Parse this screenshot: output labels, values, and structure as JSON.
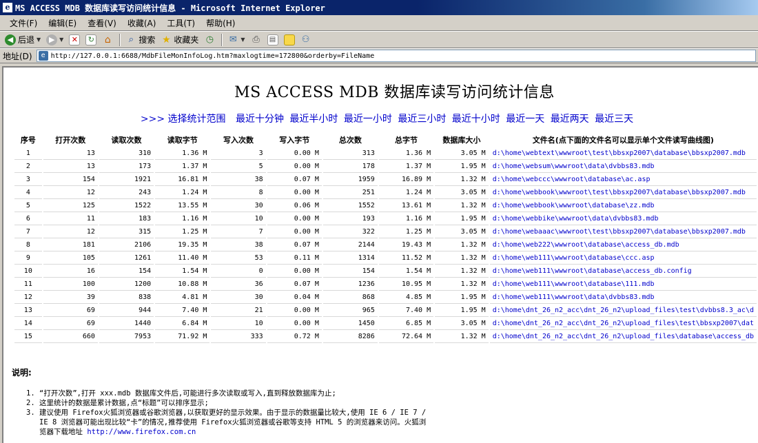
{
  "window": {
    "title": "MS ACCESS MDB 数据库读写访问统计信息 - Microsoft Internet Explorer",
    "app_icon": "e"
  },
  "menu": [
    "文件(F)",
    "编辑(E)",
    "查看(V)",
    "收藏(A)",
    "工具(T)",
    "帮助(H)"
  ],
  "toolbar": {
    "back_label": "后退",
    "search_label": "搜索",
    "favorites_label": "收藏夹"
  },
  "address": {
    "label": "地址(D)",
    "url": "http://127.0.0.1:6688/MdbFileMonInfoLog.htm?maxlogtime=172800&orderby=FileName"
  },
  "page": {
    "title": "MS ACCESS MDB 数据库读写访问统计信息",
    "range_prefix": ">>> 选择统计范围",
    "range_links": [
      "最近十分钟",
      "最近半小时",
      "最近一小时",
      "最近三小时",
      "最近十小时",
      "最近一天",
      "最近两天",
      "最近三天"
    ]
  },
  "table": {
    "headers": [
      "序号",
      "打开次数",
      "读取次数",
      "读取字节",
      "写入次数",
      "写入字节",
      "总次数",
      "总字节",
      "数据库大小",
      "文件名(点下面的文件名可以显示单个文件读写曲线图)"
    ],
    "rows": [
      [
        "1",
        "13",
        "310",
        "1.36 M",
        "3",
        "0.00 M",
        "313",
        "1.36 M",
        "3.05 M",
        "d:\\home\\webtext\\wwwroot\\test\\bbsxp2007\\database\\bbsxp2007.mdb"
      ],
      [
        "2",
        "13",
        "173",
        "1.37 M",
        "5",
        "0.00 M",
        "178",
        "1.37 M",
        "1.95 M",
        "d:\\home\\websum\\wwwroot\\data\\dvbbs83.mdb"
      ],
      [
        "3",
        "154",
        "1921",
        "16.81 M",
        "38",
        "0.07 M",
        "1959",
        "16.89 M",
        "1.32 M",
        "d:\\home\\webccc\\wwwroot\\database\\ac.asp"
      ],
      [
        "4",
        "12",
        "243",
        "1.24 M",
        "8",
        "0.00 M",
        "251",
        "1.24 M",
        "3.05 M",
        "d:\\home\\webbook\\wwwroot\\test\\bbsxp2007\\database\\bbsxp2007.mdb"
      ],
      [
        "5",
        "125",
        "1522",
        "13.55 M",
        "30",
        "0.06 M",
        "1552",
        "13.61 M",
        "1.32 M",
        "d:\\home\\webbook\\wwwroot\\database\\zz.mdb"
      ],
      [
        "6",
        "11",
        "183",
        "1.16 M",
        "10",
        "0.00 M",
        "193",
        "1.16 M",
        "1.95 M",
        "d:\\home\\webbike\\wwwroot\\data\\dvbbs83.mdb"
      ],
      [
        "7",
        "12",
        "315",
        "1.25 M",
        "7",
        "0.00 M",
        "322",
        "1.25 M",
        "3.05 M",
        "d:\\home\\webaaac\\wwwroot\\test\\bbsxp2007\\database\\bbsxp2007.mdb"
      ],
      [
        "8",
        "181",
        "2106",
        "19.35 M",
        "38",
        "0.07 M",
        "2144",
        "19.43 M",
        "1.32 M",
        "d:\\home\\web222\\wwwroot\\database\\access_db.mdb"
      ],
      [
        "9",
        "105",
        "1261",
        "11.40 M",
        "53",
        "0.11 M",
        "1314",
        "11.52 M",
        "1.32 M",
        "d:\\home\\web111\\wwwroot\\database\\ccc.asp"
      ],
      [
        "10",
        "16",
        "154",
        "1.54 M",
        "0",
        "0.00 M",
        "154",
        "1.54 M",
        "1.32 M",
        "d:\\home\\web111\\wwwroot\\database\\access_db.config"
      ],
      [
        "11",
        "100",
        "1200",
        "10.88 M",
        "36",
        "0.07 M",
        "1236",
        "10.95 M",
        "1.32 M",
        "d:\\home\\web111\\wwwroot\\database\\111.mdb"
      ],
      [
        "12",
        "39",
        "838",
        "4.81 M",
        "30",
        "0.04 M",
        "868",
        "4.85 M",
        "1.95 M",
        "d:\\home\\web111\\wwwroot\\data\\dvbbs83.mdb"
      ],
      [
        "13",
        "69",
        "944",
        "7.40 M",
        "21",
        "0.00 M",
        "965",
        "7.40 M",
        "1.95 M",
        "d:\\home\\dnt_26_n2_acc\\dnt_26_n2\\upload_files\\test\\dvbbs8.3_ac\\d"
      ],
      [
        "14",
        "69",
        "1440",
        "6.84 M",
        "10",
        "0.00 M",
        "1450",
        "6.85 M",
        "3.05 M",
        "d:\\home\\dnt_26_n2_acc\\dnt_26_n2\\upload_files\\test\\bbsxp2007\\dat"
      ],
      [
        "15",
        "660",
        "7953",
        "71.92 M",
        "333",
        "0.72 M",
        "8286",
        "72.64 M",
        "1.32 M",
        "d:\\home\\dnt_26_n2_acc\\dnt_26_n2\\upload_files\\database\\access_db"
      ]
    ]
  },
  "notes": {
    "title": "说明:",
    "items": [
      "“打开次数”,打开 xxx.mdb 数据库文件后,可能进行多次读取或写入,直到释放数据库为止;",
      "这里统计的数据是累计数据,点“标题”可以排序显示;"
    ],
    "item3_text": "建议使用 Firefox火狐浏览器或谷歌浏览器,以获取更好的显示效果。由于显示的数据量比较大,使用 IE 6 / IE 7 / IE 8 浏览器可能出现比较“卡”的情况,推荐使用 Firefox火狐浏览器或谷歌等支持 HTML 5 的浏览器来访问。火狐浏览器下载地址 ",
    "item3_link": "http://www.firefox.com.cn"
  }
}
